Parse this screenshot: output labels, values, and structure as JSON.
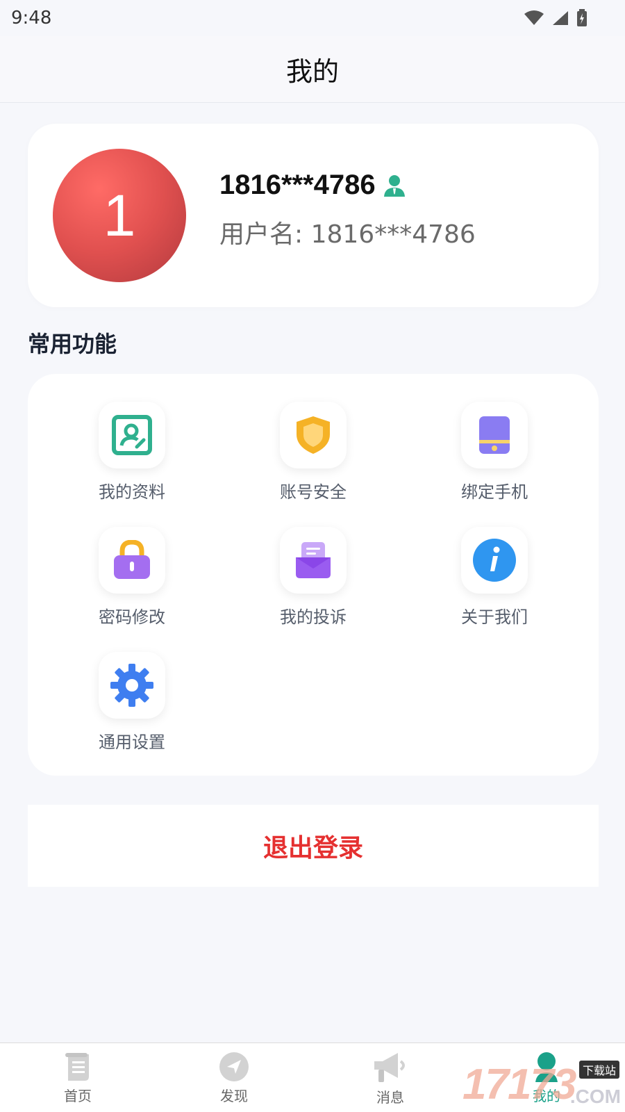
{
  "status_bar": {
    "time": "9:48"
  },
  "header": {
    "title": "我的"
  },
  "profile": {
    "avatar_initial": "1",
    "display_name": "1816***4786",
    "username_label": "用户名: 1816***4786"
  },
  "common_functions": {
    "title": "常用功能",
    "items": [
      {
        "label": "我的资料",
        "icon": "profile-card-icon",
        "color": "#2fb08e"
      },
      {
        "label": "账号安全",
        "icon": "shield-icon",
        "color": "#f5b226"
      },
      {
        "label": "绑定手机",
        "icon": "phone-icon",
        "color": "#8a7cf2"
      },
      {
        "label": "密码修改",
        "icon": "lock-icon",
        "color": "#a46ef0"
      },
      {
        "label": "我的投诉",
        "icon": "complaint-icon",
        "color": "#9a5cf0"
      },
      {
        "label": "关于我们",
        "icon": "info-icon",
        "color": "#2f96f0"
      },
      {
        "label": "通用设置",
        "icon": "gear-icon",
        "color": "#3f7ef0"
      }
    ]
  },
  "logout": {
    "label": "退出登录",
    "color": "#e53030"
  },
  "tabbar": {
    "tabs": [
      {
        "label": "首页",
        "icon": "home-scroll-icon"
      },
      {
        "label": "发现",
        "icon": "discover-icon"
      },
      {
        "label": "消息",
        "icon": "megaphone-icon"
      },
      {
        "label": "我的",
        "icon": "user-icon",
        "active": true
      }
    ]
  },
  "watermark": {
    "digits": "17173",
    "domain": ".COM",
    "tag": "下载站"
  }
}
